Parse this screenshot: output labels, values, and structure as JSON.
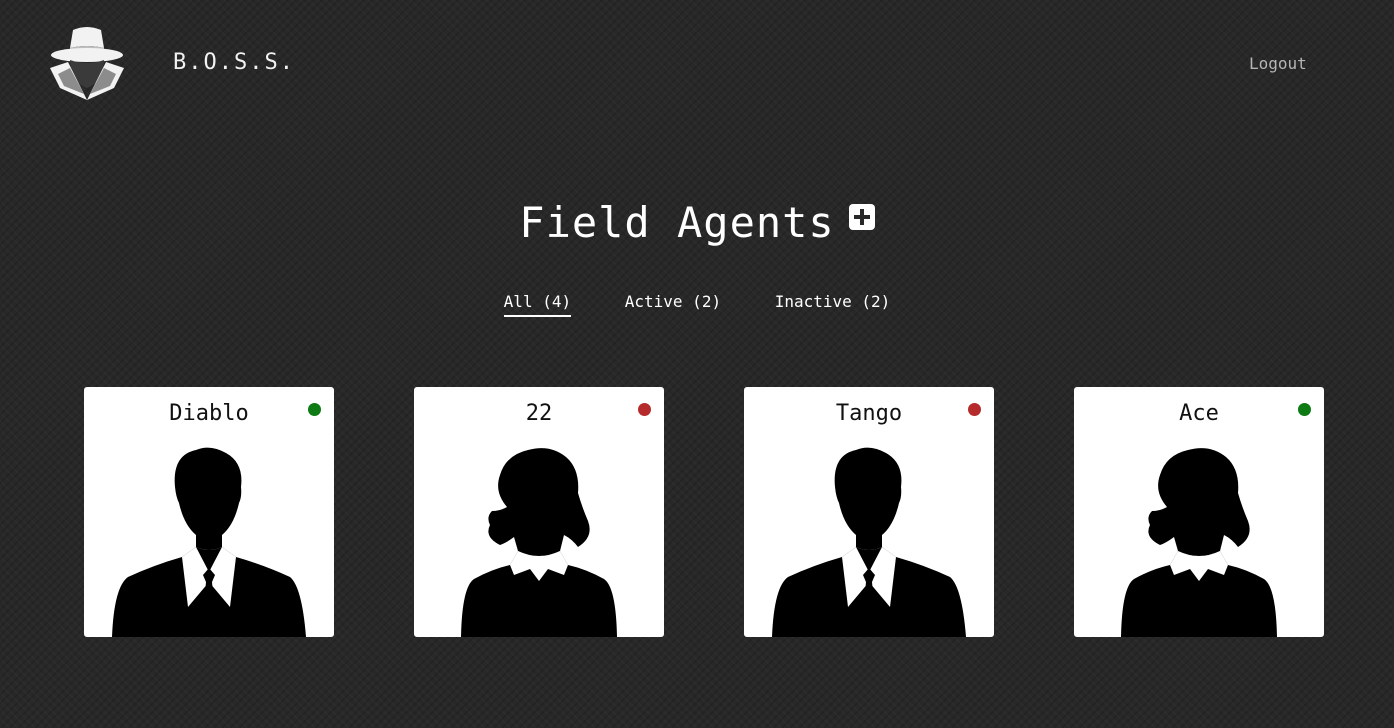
{
  "header": {
    "brand": "B.O.S.S.",
    "logout_label": "Logout"
  },
  "main": {
    "title": "Field Agents",
    "add_icon": "plus-square-icon"
  },
  "tabs": [
    {
      "label": "All (4)",
      "active": true
    },
    {
      "label": "Active (2)",
      "active": false
    },
    {
      "label": "Inactive (2)",
      "active": false
    }
  ],
  "agents": [
    {
      "name": "Diablo",
      "status": "active",
      "avatar": "male-silhouette"
    },
    {
      "name": "22",
      "status": "inactive",
      "avatar": "female-silhouette"
    },
    {
      "name": "Tango",
      "status": "inactive",
      "avatar": "male-silhouette"
    },
    {
      "name": "Ace",
      "status": "active",
      "avatar": "female-silhouette"
    }
  ],
  "colors": {
    "background": "#282828",
    "active": "#0d7a14",
    "inactive": "#b52b2b"
  }
}
